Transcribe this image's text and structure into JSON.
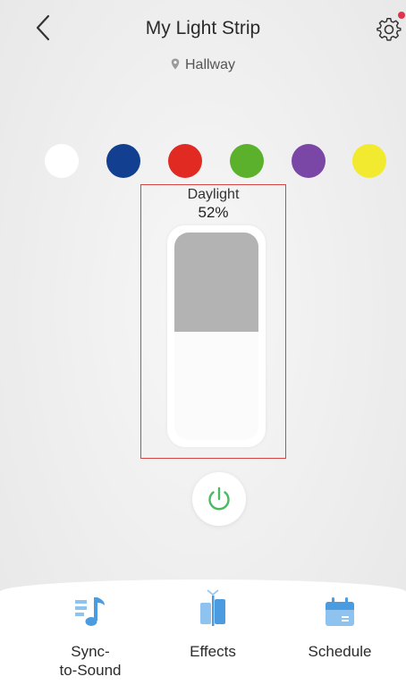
{
  "header": {
    "title": "My Light Strip",
    "back_icon": "chevron-left-icon",
    "settings_icon": "gear-icon",
    "notification_dot_color": "#e0344a"
  },
  "location": {
    "icon": "location-pin-icon",
    "name": "Hallway"
  },
  "color_presets": [
    {
      "name": "white",
      "color": "#ffffff"
    },
    {
      "name": "blue",
      "color": "#123f8f"
    },
    {
      "name": "red",
      "color": "#e02a22"
    },
    {
      "name": "green",
      "color": "#5bb02c"
    },
    {
      "name": "purple",
      "color": "#7a47a6"
    },
    {
      "name": "yellow",
      "color": "#f2ea2e"
    }
  ],
  "brightness": {
    "mode": "Daylight",
    "percent_label": "52%",
    "value": 0.52,
    "highlight_color": "#d64545"
  },
  "power": {
    "icon": "power-icon",
    "color": "#4cba63"
  },
  "bottom_tabs": [
    {
      "label": "Sync-\nto-Sound",
      "icon": "music-note-icon"
    },
    {
      "label": "Effects",
      "icon": "effects-icon"
    },
    {
      "label": "Schedule",
      "icon": "calendar-icon"
    }
  ],
  "accent_color": "#4a9be0"
}
